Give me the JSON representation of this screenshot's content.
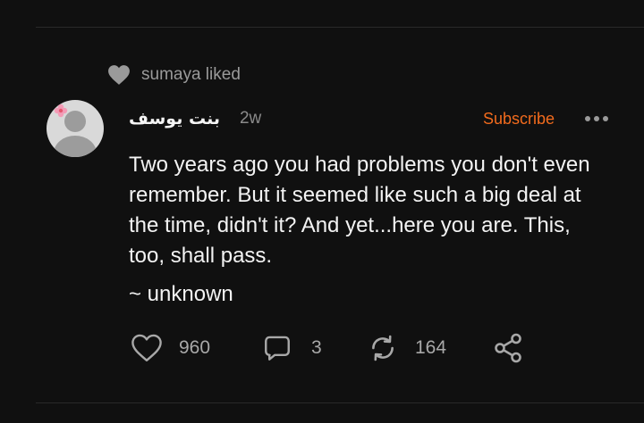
{
  "activity": {
    "liked_text": "sumaya liked",
    "icon": "heart-filled-icon"
  },
  "post": {
    "author": "بنت يوسف",
    "time": "2w",
    "subscribe_label": "Subscribe",
    "body": "Two years ago you had problems you don't even remember. But it seemed like such a big deal at the time, didn't it? And yet...here you are. This, too, shall pass.",
    "signature": "~ unknown"
  },
  "actions": {
    "likes": "960",
    "comments": "3",
    "restacks": "164"
  },
  "colors": {
    "background": "#101010",
    "accent": "#f26b1d",
    "muted": "#9a9a9a"
  }
}
